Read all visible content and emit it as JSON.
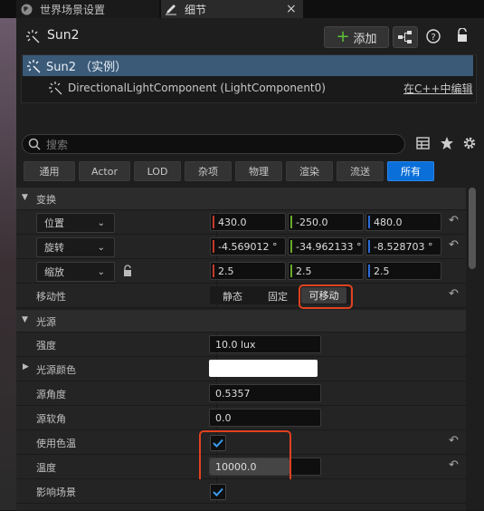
{
  "tabs": [
    {
      "label": "世界场景设置",
      "icon": "globe-icon"
    },
    {
      "label": "细节",
      "icon": "pencil-icon",
      "close": "×"
    }
  ],
  "header": {
    "title": "Sun2",
    "add_label": "添加"
  },
  "tree": {
    "row1": "Sun2 （实例）",
    "row2": "DirectionalLightComponent (LightComponent0)",
    "edit_link": "在C++中编辑"
  },
  "search": {
    "placeholder": "搜索"
  },
  "filters": [
    "通用",
    "Actor",
    "LOD",
    "杂项",
    "物理",
    "渲染",
    "流送",
    "所有"
  ],
  "transform": {
    "section": "变换",
    "location": {
      "label": "位置",
      "x": "430.0",
      "y": "-250.0",
      "z": "480.0"
    },
    "rotation": {
      "label": "旋转",
      "x": "-4.569012 °",
      "y": "-34.962133 °",
      "z": "-8.528703 °"
    },
    "scale": {
      "label": "缩放",
      "x": "2.5",
      "y": "2.5",
      "z": "2.5"
    },
    "mobility": {
      "label": "移动性",
      "options": [
        "静态",
        "固定",
        "可移动"
      ],
      "selected": "可移动"
    }
  },
  "light": {
    "section": "光源",
    "intensity": {
      "label": "强度",
      "value": "10.0 lux"
    },
    "color": {
      "label": "光源颜色",
      "value": "#ffffff"
    },
    "source_angle": {
      "label": "源角度",
      "value": "0.5357"
    },
    "source_soft_angle": {
      "label": "源软角",
      "value": "0.0"
    },
    "use_temperature": {
      "label": "使用色温",
      "checked": true
    },
    "temperature": {
      "label": "温度",
      "value": "10000.0"
    },
    "affects_world": {
      "label": "影响场景",
      "checked": true
    }
  },
  "colors": {
    "accent": "#0a6fd8",
    "highlight": "#e0421f",
    "x_axis": "#c23a2a",
    "y_axis": "#6aa82a",
    "z_axis": "#2a6ad6"
  }
}
